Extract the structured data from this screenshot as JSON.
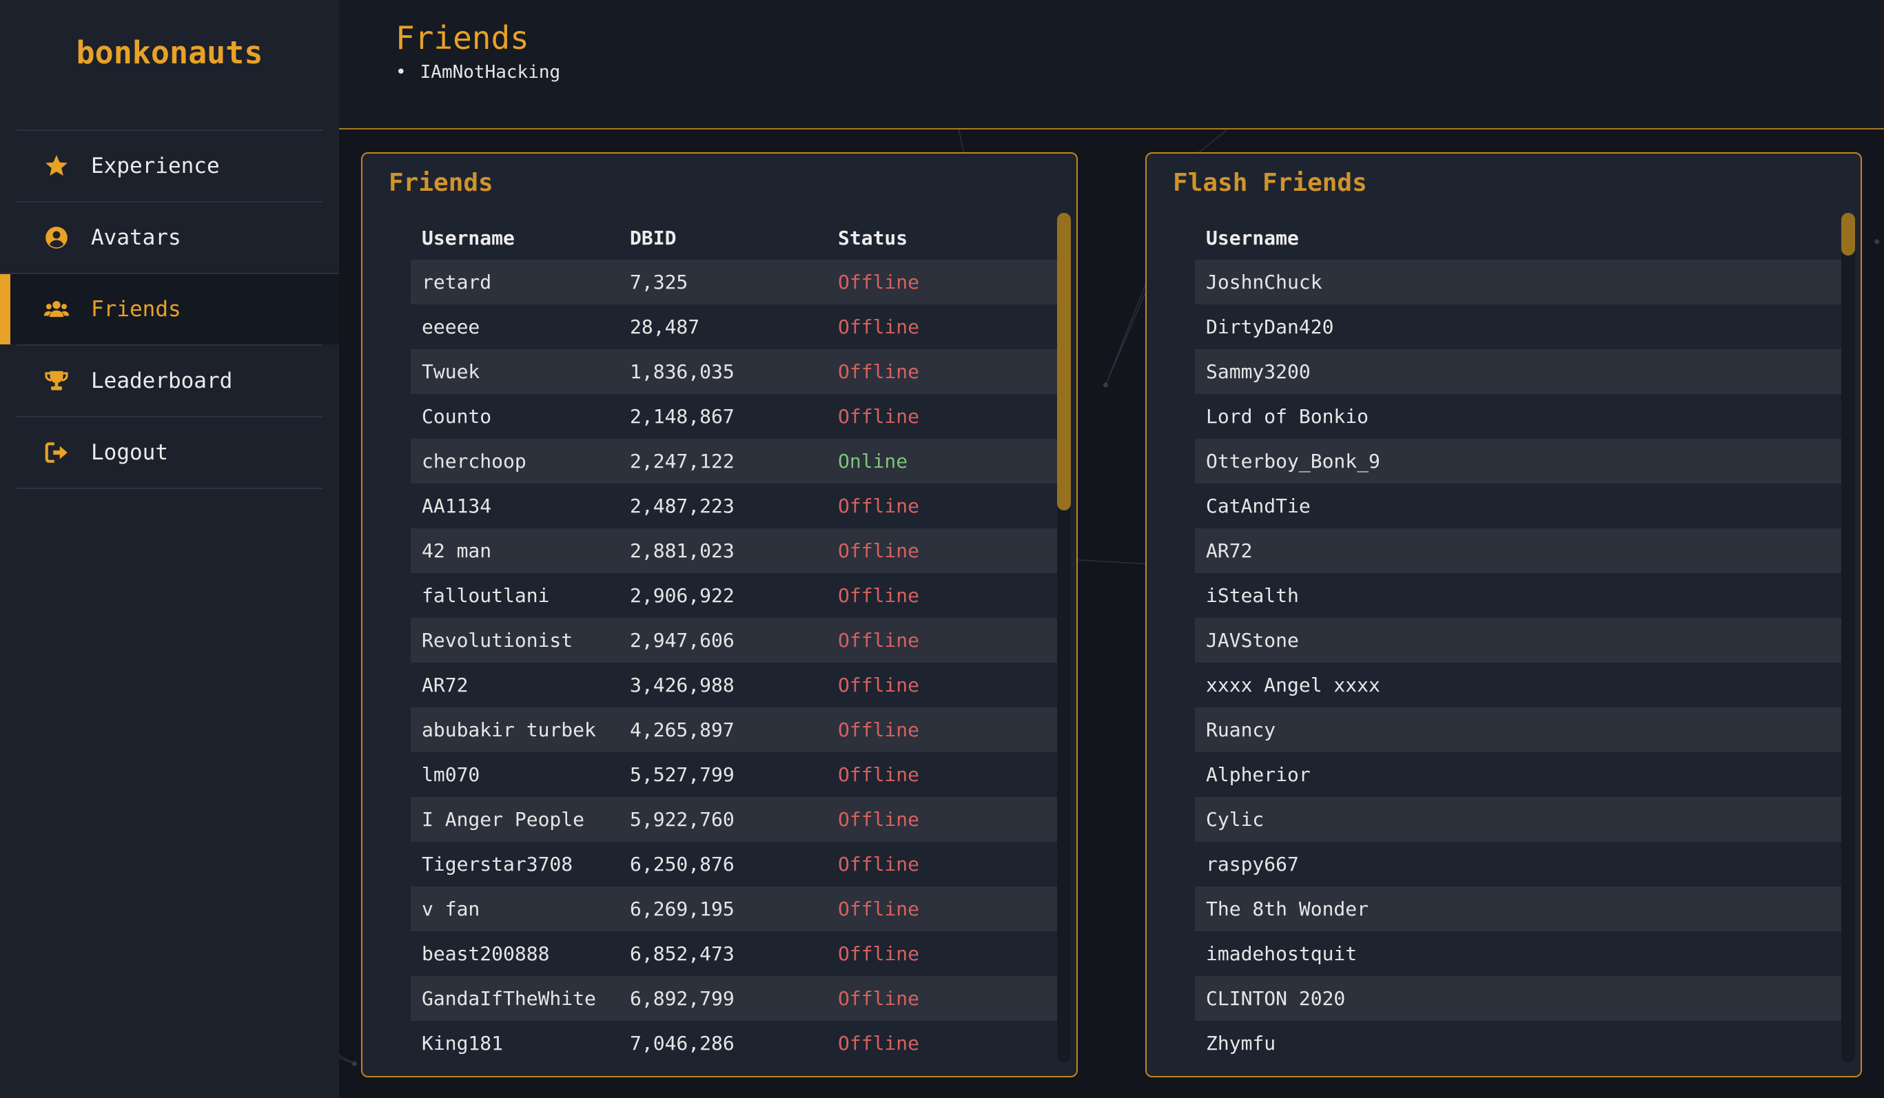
{
  "app": {
    "brand": "bonkonauts"
  },
  "colors": {
    "accent": "#e8a227",
    "online": "#7fc47a",
    "offline": "#d4625f",
    "panel_border": "#c0871d"
  },
  "nav": [
    {
      "label": "Experience",
      "icon": "star-icon",
      "active": false
    },
    {
      "label": "Avatars",
      "icon": "user-circle-icon",
      "active": false
    },
    {
      "label": "Friends",
      "icon": "users-icon",
      "active": true
    },
    {
      "label": "Leaderboard",
      "icon": "trophy-icon",
      "active": false
    },
    {
      "label": "Logout",
      "icon": "logout-icon",
      "active": false
    }
  ],
  "header": {
    "title": "Friends",
    "items": [
      "IAmNotHacking"
    ]
  },
  "friends": {
    "title": "Friends",
    "columns": [
      "Username",
      "DBID",
      "Status"
    ],
    "rows": [
      {
        "username": "retard",
        "dbid": "7,325",
        "status": "Offline"
      },
      {
        "username": "eeeee",
        "dbid": "28,487",
        "status": "Offline"
      },
      {
        "username": "Twuek",
        "dbid": "1,836,035",
        "status": "Offline"
      },
      {
        "username": "Counto",
        "dbid": "2,148,867",
        "status": "Offline"
      },
      {
        "username": "cherchoop",
        "dbid": "2,247,122",
        "status": "Online"
      },
      {
        "username": "AA1134",
        "dbid": "2,487,223",
        "status": "Offline"
      },
      {
        "username": "42 man",
        "dbid": "2,881,023",
        "status": "Offline"
      },
      {
        "username": "falloutlani",
        "dbid": "2,906,922",
        "status": "Offline"
      },
      {
        "username": "Revolutionist",
        "dbid": "2,947,606",
        "status": "Offline"
      },
      {
        "username": "AR72",
        "dbid": "3,426,988",
        "status": "Offline"
      },
      {
        "username": "abubakir turbek",
        "dbid": "4,265,897",
        "status": "Offline"
      },
      {
        "username": "lm070",
        "dbid": "5,527,799",
        "status": "Offline"
      },
      {
        "username": "I Anger People",
        "dbid": "5,922,760",
        "status": "Offline"
      },
      {
        "username": "Tigerstar3708",
        "dbid": "6,250,876",
        "status": "Offline"
      },
      {
        "username": "v fan",
        "dbid": "6,269,195",
        "status": "Offline"
      },
      {
        "username": "beast200888",
        "dbid": "6,852,473",
        "status": "Offline"
      },
      {
        "username": "GandaIfTheWhite",
        "dbid": "6,892,799",
        "status": "Offline"
      },
      {
        "username": "King181",
        "dbid": "7,046,286",
        "status": "Offline"
      }
    ],
    "scroll_position": 0.0,
    "scroll_visible_fraction": 0.35
  },
  "flash_friends": {
    "title": "Flash Friends",
    "columns": [
      "Username"
    ],
    "rows": [
      "JoshnChuck",
      "DirtyDan420",
      "Sammy3200",
      "Lord of Bonkio",
      "Otterboy_Bonk_9",
      "CatAndTie",
      "AR72",
      "iStealth",
      "JAVStone",
      "xxxx Angel xxxx",
      "Ruancy",
      "Alpherior",
      "Cylic",
      "raspy667",
      "The 8th Wonder",
      "imadehostquit",
      "CLINTON 2020",
      "Zhymfu"
    ],
    "scroll_position": 0.0,
    "scroll_visible_fraction": 0.05
  }
}
